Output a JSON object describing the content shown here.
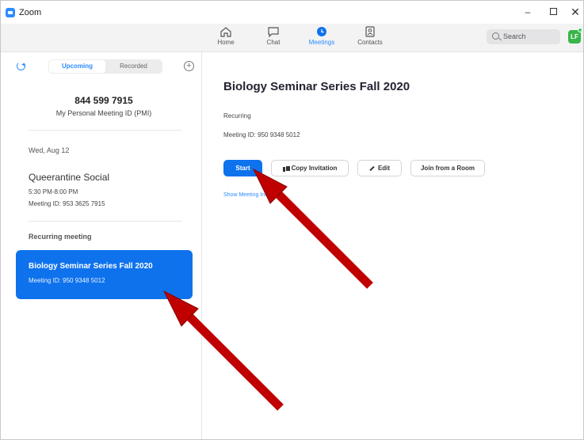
{
  "window": {
    "title": "Zoom"
  },
  "window_controls": {
    "minimize": "–",
    "close": "✕"
  },
  "nav": {
    "items": [
      {
        "label": "Home",
        "icon": "home-icon"
      },
      {
        "label": "Chat",
        "icon": "chat-icon"
      },
      {
        "label": "Meetings",
        "icon": "clock-icon",
        "active": true
      },
      {
        "label": "Contacts",
        "icon": "contacts-icon"
      }
    ],
    "search_placeholder": "Search",
    "avatar_initials": "LF"
  },
  "sidebar": {
    "tabs": {
      "upcoming": "Upcoming",
      "recorded": "Recorded"
    },
    "add_symbol": "+",
    "pmi": {
      "number": "844 599 7915",
      "label": "My Personal Meeting ID (PMI)"
    },
    "date_header": "Wed, Aug 12",
    "meeting": {
      "title": "Queerantine Social",
      "time": "5:30 PM-8:00 PM",
      "id": "Meeting ID: 953 3625 7915"
    },
    "recurring_header": "Recurring meeting",
    "selected": {
      "title": "Biology Seminar Series Fall 2020",
      "id": "Meeting ID: 950 9348 5012"
    }
  },
  "main": {
    "title": "Biology Seminar Series Fall 2020",
    "recurring": "Recurring",
    "meeting_id": "Meeting ID: 950 9348 5012",
    "buttons": {
      "start": "Start",
      "copy": "Copy Invitation",
      "edit": "Edit",
      "join_room": "Join from a Room"
    },
    "show_link": "Show Meeting Invitation"
  },
  "colors": {
    "accent": "#0e72ed",
    "annotation_arrow": "#c00000",
    "avatar": "#39b54a"
  }
}
